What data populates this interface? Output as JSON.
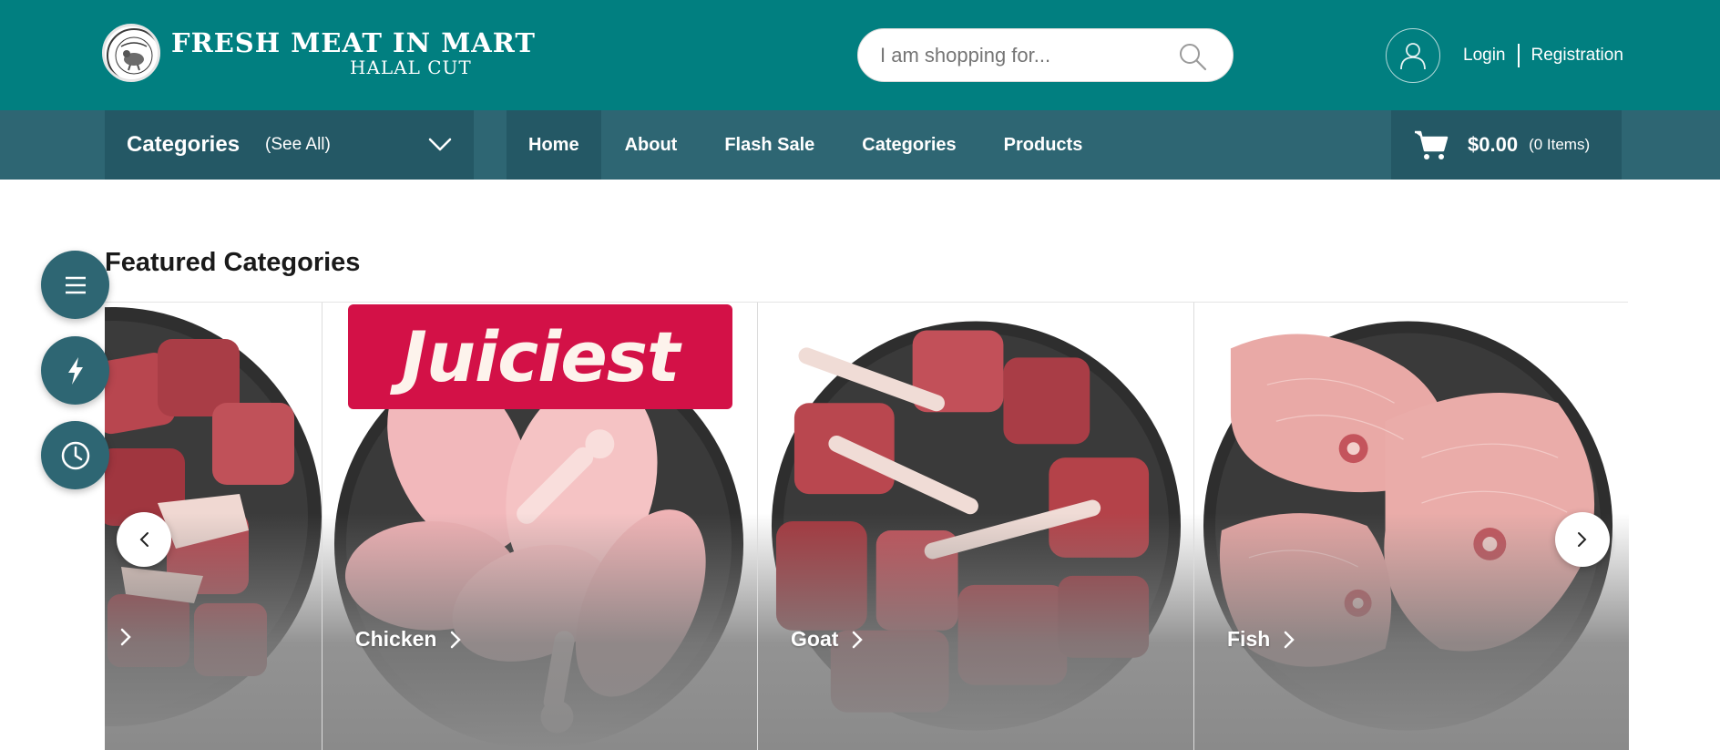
{
  "brand": {
    "title": "FRESH MEAT IN MART",
    "subtitle": "HALAL CUT",
    "seal_text": "FRESH MEAT IN MART",
    "color_header": "#017f80",
    "color_nav": "#2e6673",
    "color_nav_dark": "#245865"
  },
  "search": {
    "placeholder": "I am shopping for...",
    "value": "",
    "icon": "search-icon"
  },
  "account": {
    "icon": "user-icon",
    "login_label": "Login",
    "register_label": "Registration"
  },
  "nav": {
    "categories_title": "Categories",
    "categories_see_all": "(See All)",
    "items": [
      {
        "label": "Home",
        "active": true
      },
      {
        "label": "About",
        "active": false
      },
      {
        "label": "Flash Sale",
        "active": false
      },
      {
        "label": "Categories",
        "active": false
      },
      {
        "label": "Products",
        "active": false
      }
    ]
  },
  "cart": {
    "icon": "cart-icon",
    "amount": "$0.00",
    "count": "(0 Items)"
  },
  "featured": {
    "title": "Featured Categories",
    "cards": [
      {
        "label": "",
        "image": "lamb-cubes"
      },
      {
        "label": "Chicken",
        "image": "chicken-drumsticks",
        "badge": "Juiciest"
      },
      {
        "label": "Goat",
        "image": "goat-chops"
      },
      {
        "label": "Fish",
        "image": "fish-steaks"
      }
    ],
    "prev_icon": "chevron-left-icon",
    "next_icon": "chevron-right-icon",
    "badge_color": "#d31147"
  },
  "floating": [
    {
      "icon": "menu-icon"
    },
    {
      "icon": "flash-icon"
    },
    {
      "icon": "clock-icon"
    }
  ]
}
